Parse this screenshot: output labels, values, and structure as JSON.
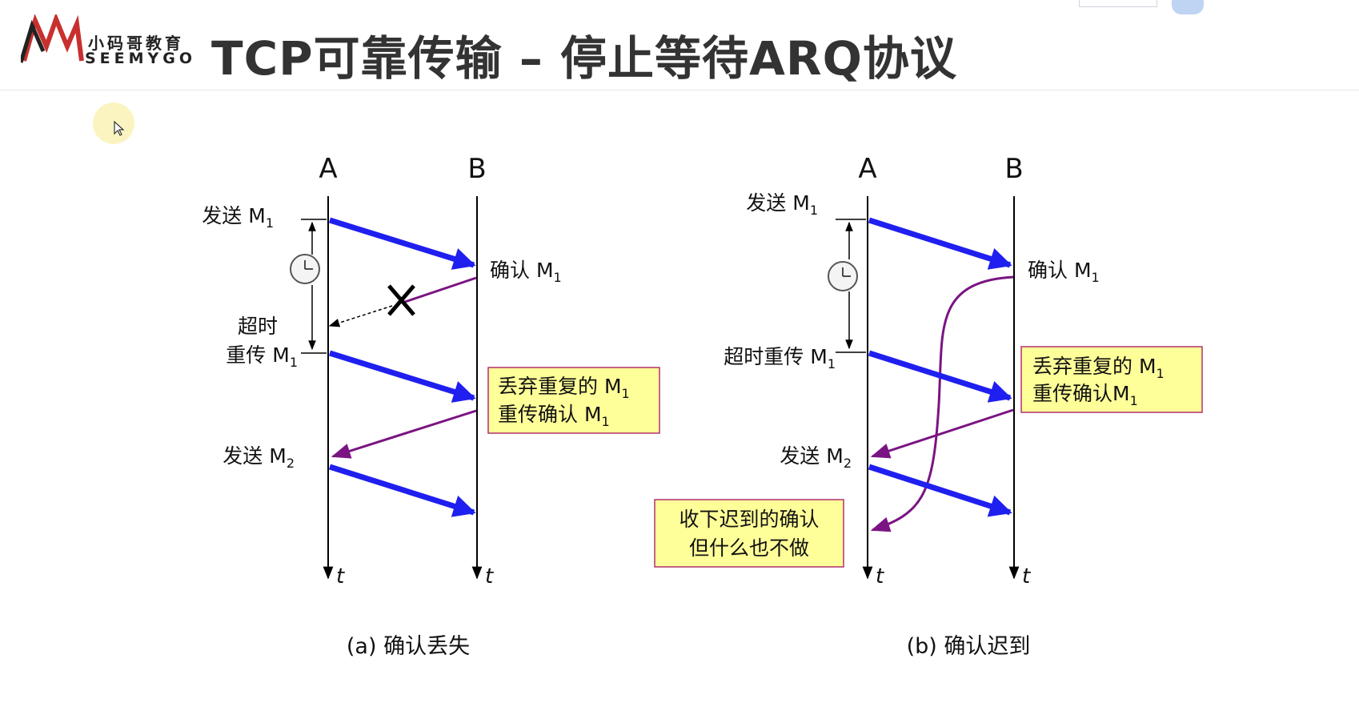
{
  "header": {
    "logo": {
      "name_cn": "小码哥教育",
      "name_en": "SEEMYGO"
    },
    "title": "TCP可靠传输 – 停止等待ARQ协议"
  },
  "colors": {
    "data_arrow": "#1f1ff0",
    "ack_arrow": "#7a1482",
    "note_fill": "#ffff99",
    "note_border": "#b0306e"
  },
  "icons": [
    "clock-icon",
    "cross-icon",
    "cursor-icon"
  ],
  "diagrams": [
    {
      "id": "a",
      "caption": "(a) 确认丢失",
      "host_a": "A",
      "host_b": "B",
      "time_label": "t",
      "send_m1": "发送",
      "ack_m1": "确认",
      "timeout_line1": "超时",
      "timeout_line2": "重传",
      "note_line1": "丢弃重复的",
      "note_line2": "重传确认",
      "send_m2": "发送"
    },
    {
      "id": "b",
      "caption": "(b) 确认迟到",
      "host_a": "A",
      "host_b": "B",
      "time_label": "t",
      "send_m1": "发送",
      "ack_m1": "确认",
      "timeout": "超时重传",
      "note_line1": "丢弃重复的",
      "note_line2": "重传确认",
      "send_m2": "发送",
      "late_note_line1": "收下迟到的确认",
      "late_note_line2": "但什么也不做"
    }
  ],
  "msg": {
    "m": "M",
    "sub1": "1",
    "sub2": "2"
  }
}
